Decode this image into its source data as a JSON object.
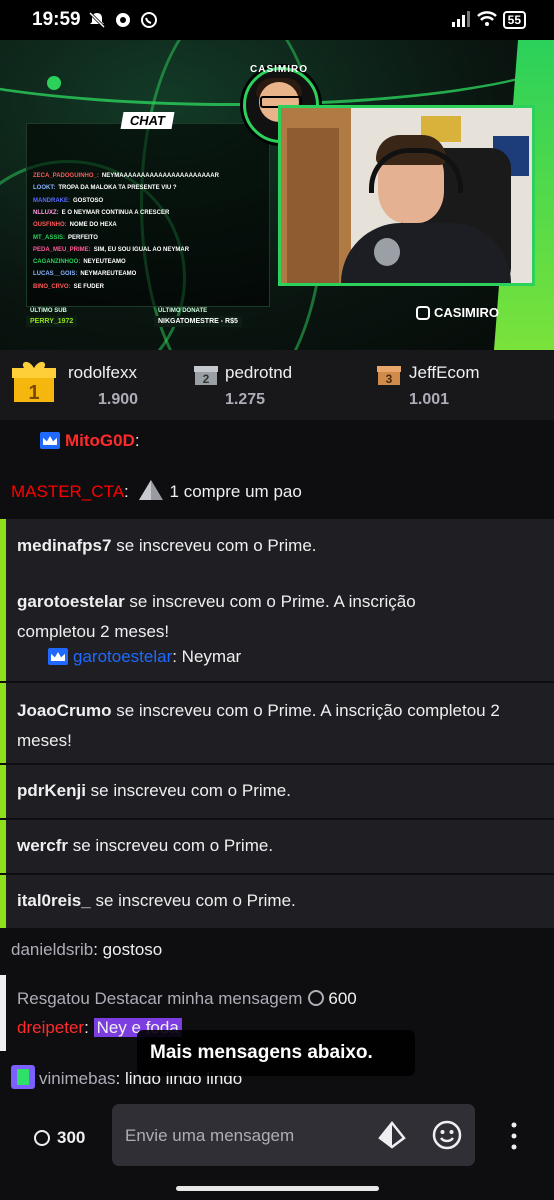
{
  "status_bar": {
    "time": "19:59",
    "battery": "55"
  },
  "stream_overlay": {
    "chat_title": "CHAT",
    "logo_text": "CASIMIRO",
    "chat_lines": [
      {
        "user": "ZECA_PADOGUINHO_:",
        "text": "NEYMAAAAAAAAAAAAAAAAAAAAAAR",
        "color": "#ff5a5a"
      },
      {
        "user": "LOOKT:",
        "text": "TROPA DA MALOKA TA PRESENTE VIU ?",
        "color": "#8ab4ff"
      },
      {
        "user": "MANDRAKE:",
        "text": "GOSTOSO",
        "color": "#5a6bff"
      },
      {
        "user": "NLLUXZ:",
        "text": "E O NEYMAR CONTINUA A CRESCER",
        "color": "#ff9adf"
      },
      {
        "user": "OUSFINHO:",
        "text": "NOME DO HEXA",
        "color": "#ff5a5a"
      },
      {
        "user": "MT_ASSIS:",
        "text": "PERFEITO",
        "color": "#2bd15b"
      },
      {
        "user": "PEDA_MEU_PRIME:",
        "text": "SIM, EU SOU IGUAL AO NEYMAR",
        "color": "#ff5a9a"
      },
      {
        "user": "CAGANZINHOO:",
        "text": "NEYEUTEAMO",
        "color": "#2bd15b"
      },
      {
        "user": "LUCAS__GOIS:",
        "text": "NEYMAREUTEAMO",
        "color": "#8ab4ff"
      },
      {
        "user": "BINO_CRVO:",
        "text": "SE FUDER",
        "color": "#ff5a5a"
      }
    ],
    "last_sub_label": "ÚLTIMO SUB",
    "last_sub_value": "PERRY_1972",
    "last_donate_label": "ÚLTIMO DONATE",
    "last_donate_value": "NIKGATOMESTRE - R$5",
    "instagram": "CASIMIRO"
  },
  "leaderboard": [
    {
      "rank": "1",
      "name": "rodolfexx",
      "score": "1.900"
    },
    {
      "rank": "2",
      "name": "pedrotnd",
      "score": "1.275"
    },
    {
      "rank": "3",
      "name": "JeffEcom",
      "score": "1.001"
    }
  ],
  "chat": {
    "msg1": {
      "user": "MitoG0D",
      "sep": ":"
    },
    "msg2": {
      "user": "MASTER_CTA",
      "sep": ":",
      "text": "1 compre um pao"
    },
    "subs": [
      {
        "user": "medinafps7",
        "text": " se inscreveu com o Prime."
      },
      {
        "user": "garotoestelar",
        "text": " se inscreveu com o Prime. A inscrição completou 2 meses!",
        "reply_user": "garotoestelar",
        "reply_text": ": Neymar"
      },
      {
        "user": "JoaoCrumo",
        "text": " se inscreveu com o Prime. A inscrição completou 2 meses!"
      },
      {
        "user": "pdrKenji",
        "text": " se inscreveu com o Prime."
      },
      {
        "user": "wercfr",
        "text": " se inscreveu com o Prime."
      },
      {
        "user": "ital0reis_",
        "text": " se inscreveu com o Prime."
      }
    ],
    "msg3": {
      "user": "danieldsrib",
      "text": ": gostoso"
    },
    "redeem": {
      "text": "Resgatou Destacar minha mensagem",
      "cost": "600",
      "user": "dreipeter",
      "sep": ": ",
      "message": "Ney e foda"
    },
    "msg4": {
      "user": "vinimebas",
      "text": ": lindo lindo lindo"
    },
    "toast": "Mais mensagens abaixo."
  },
  "input": {
    "points": "300",
    "placeholder": "Envie uma mensagem"
  },
  "colors": {
    "accent": "#8ee01b",
    "twitch_bg": "#0e0e10",
    "red_user": "#ff0000",
    "blue_user": "#1f69ff"
  }
}
